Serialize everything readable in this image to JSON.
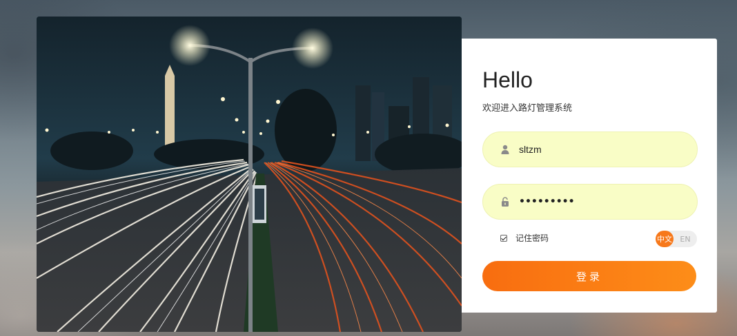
{
  "login": {
    "title": "Hello",
    "subtitle": "欢迎进入路灯管理系统",
    "username": {
      "value": "sltzm",
      "icon": "user-icon"
    },
    "password": {
      "value": "•••••••••",
      "icon": "lock-icon"
    },
    "remember_label": "记住密码",
    "remember_checked": true,
    "lang_zh": "中文",
    "lang_en": "EN",
    "submit_label": "登录"
  },
  "colors": {
    "accent": "#f7781a",
    "input_bg": "#f9fdc6"
  }
}
